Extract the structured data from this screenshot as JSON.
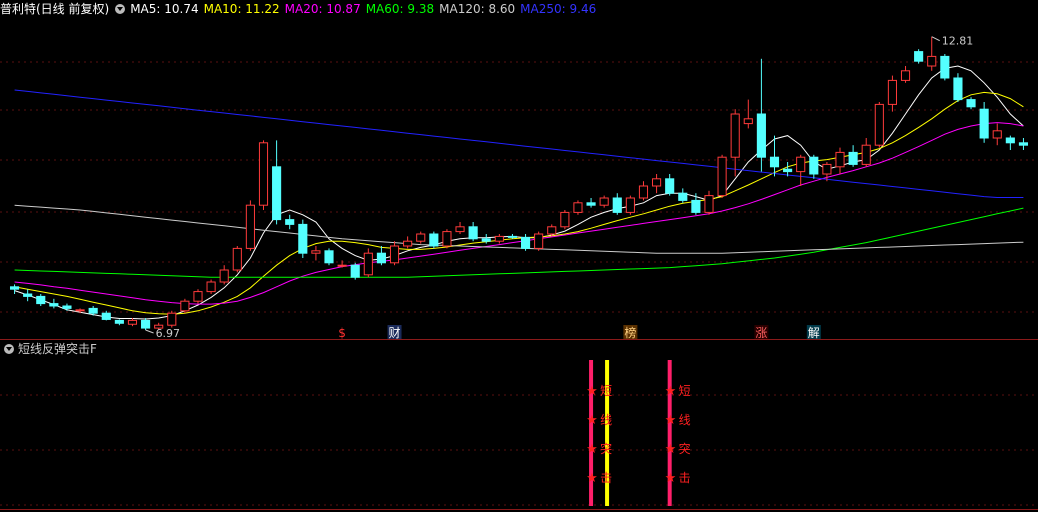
{
  "header": {
    "title": "普利特(日线 前复权)",
    "ma_items": [
      {
        "label": "MA5: 10.74",
        "color": "#ffffff"
      },
      {
        "label": "MA10: 11.22",
        "color": "#ffff00"
      },
      {
        "label": "MA20: 10.87",
        "color": "#ff00ff"
      },
      {
        "label": "MA60: 9.38",
        "color": "#00ff00"
      },
      {
        "label": "MA120: 8.60",
        "color": "#cccccc"
      },
      {
        "label": "MA250: 9.46",
        "color": "#2222ff"
      }
    ]
  },
  "indicator": {
    "title": "短线反弹突击F"
  },
  "chart_data": {
    "type": "candlestick",
    "high_label": "12.81",
    "low_label": "6.97",
    "ylim": [
      6.7,
      13.2
    ],
    "candles": [
      [
        7.6,
        7.65,
        7.45,
        7.55
      ],
      [
        7.45,
        7.55,
        7.3,
        7.4
      ],
      [
        7.4,
        7.45,
        7.2,
        7.25
      ],
      [
        7.25,
        7.35,
        7.15,
        7.2
      ],
      [
        7.2,
        7.25,
        7.1,
        7.15
      ],
      [
        7.1,
        7.15,
        7.05,
        7.12
      ],
      [
        7.15,
        7.2,
        7.0,
        7.05
      ],
      [
        7.05,
        7.1,
        6.9,
        6.92
      ],
      [
        6.9,
        6.92,
        6.8,
        6.84
      ],
      [
        6.82,
        6.95,
        6.78,
        6.9
      ],
      [
        6.9,
        6.95,
        6.7,
        6.74
      ],
      [
        6.74,
        6.85,
        6.7,
        6.8
      ],
      [
        6.8,
        7.1,
        6.75,
        7.05
      ],
      [
        7.1,
        7.35,
        7.05,
        7.3
      ],
      [
        7.3,
        7.55,
        7.25,
        7.5
      ],
      [
        7.5,
        7.75,
        7.45,
        7.7
      ],
      [
        7.7,
        8.05,
        7.65,
        7.95
      ],
      [
        7.95,
        8.45,
        7.9,
        8.4
      ],
      [
        8.4,
        9.4,
        8.35,
        9.3
      ],
      [
        9.3,
        10.65,
        9.2,
        10.6
      ],
      [
        10.1,
        10.65,
        8.9,
        9.0
      ],
      [
        9.0,
        9.1,
        8.8,
        8.9
      ],
      [
        8.9,
        9.0,
        8.2,
        8.3
      ],
      [
        8.3,
        8.45,
        8.15,
        8.35
      ],
      [
        8.35,
        8.4,
        8.05,
        8.1
      ],
      [
        8.05,
        8.15,
        8.0,
        8.05
      ],
      [
        8.05,
        8.1,
        7.75,
        7.8
      ],
      [
        7.85,
        8.4,
        7.8,
        8.3
      ],
      [
        8.3,
        8.45,
        8.05,
        8.1
      ],
      [
        8.1,
        8.55,
        8.05,
        8.45
      ],
      [
        8.45,
        8.65,
        8.4,
        8.55
      ],
      [
        8.55,
        8.75,
        8.5,
        8.7
      ],
      [
        8.7,
        8.75,
        8.4,
        8.45
      ],
      [
        8.45,
        8.8,
        8.4,
        8.75
      ],
      [
        8.75,
        8.95,
        8.7,
        8.85
      ],
      [
        8.85,
        8.95,
        8.55,
        8.6
      ],
      [
        8.6,
        8.7,
        8.5,
        8.55
      ],
      [
        8.55,
        8.7,
        8.5,
        8.65
      ],
      [
        8.65,
        8.7,
        8.6,
        8.63
      ],
      [
        8.63,
        8.7,
        8.35,
        8.4
      ],
      [
        8.4,
        8.75,
        8.35,
        8.7
      ],
      [
        8.7,
        8.9,
        8.65,
        8.85
      ],
      [
        8.85,
        9.2,
        8.8,
        9.15
      ],
      [
        9.15,
        9.4,
        9.1,
        9.35
      ],
      [
        9.35,
        9.45,
        9.25,
        9.3
      ],
      [
        9.3,
        9.5,
        9.25,
        9.45
      ],
      [
        9.45,
        9.55,
        9.1,
        9.15
      ],
      [
        9.15,
        9.5,
        9.1,
        9.45
      ],
      [
        9.45,
        9.8,
        9.4,
        9.7
      ],
      [
        9.7,
        9.95,
        9.55,
        9.85
      ],
      [
        9.85,
        9.95,
        9.5,
        9.55
      ],
      [
        9.55,
        9.65,
        9.35,
        9.4
      ],
      [
        9.4,
        9.55,
        9.1,
        9.15
      ],
      [
        9.15,
        9.6,
        9.1,
        9.5
      ],
      [
        9.5,
        10.35,
        9.45,
        10.3
      ],
      [
        10.3,
        11.3,
        9.9,
        11.2
      ],
      [
        11.0,
        11.5,
        10.9,
        11.1
      ],
      [
        11.2,
        12.35,
        10.0,
        10.3
      ],
      [
        10.3,
        10.75,
        9.9,
        10.1
      ],
      [
        10.05,
        10.2,
        9.9,
        10.0
      ],
      [
        10.0,
        10.35,
        9.7,
        10.3
      ],
      [
        10.3,
        10.35,
        9.85,
        9.95
      ],
      [
        9.95,
        10.2,
        9.8,
        10.15
      ],
      [
        10.1,
        10.5,
        9.95,
        10.4
      ],
      [
        10.4,
        10.55,
        10.1,
        10.15
      ],
      [
        10.15,
        10.7,
        10.1,
        10.55
      ],
      [
        10.55,
        11.45,
        10.5,
        11.4
      ],
      [
        11.4,
        12.0,
        11.25,
        11.9
      ],
      [
        11.9,
        12.2,
        11.85,
        12.1
      ],
      [
        12.5,
        12.55,
        12.25,
        12.3
      ],
      [
        12.2,
        12.81,
        12.1,
        12.4
      ],
      [
        12.4,
        12.45,
        11.9,
        11.95
      ],
      [
        11.95,
        12.05,
        11.45,
        11.5
      ],
      [
        11.5,
        11.55,
        11.3,
        11.35
      ],
      [
        11.3,
        11.45,
        10.6,
        10.7
      ],
      [
        10.7,
        11.0,
        10.55,
        10.85
      ],
      [
        10.7,
        10.75,
        10.45,
        10.6
      ],
      [
        10.6,
        10.7,
        10.45,
        10.55
      ]
    ],
    "ma": [
      {
        "name": "MA5",
        "color": "#ffffff",
        "values": [
          7.52,
          7.43,
          7.33,
          7.23,
          7.12,
          7.07,
          7.02,
          6.97,
          6.94,
          6.94,
          6.93,
          6.95,
          7.0,
          7.1,
          7.22,
          7.38,
          7.58,
          7.85,
          8.2,
          8.72,
          9.1,
          9.2,
          9.1,
          8.95,
          8.6,
          8.4,
          8.25,
          8.15,
          8.18,
          8.25,
          8.35,
          8.42,
          8.47,
          8.55,
          8.6,
          8.62,
          8.62,
          8.64,
          8.65,
          8.62,
          8.62,
          8.68,
          8.76,
          8.9,
          9.05,
          9.15,
          9.23,
          9.28,
          9.35,
          9.5,
          9.55,
          9.55,
          9.48,
          9.4,
          9.5,
          9.85,
          10.2,
          10.45,
          10.68,
          10.75,
          10.55,
          10.2,
          10.05,
          10.12,
          10.2,
          10.25,
          10.45,
          10.8,
          11.2,
          11.6,
          11.95,
          12.15,
          12.2,
          12.1,
          11.85,
          11.55,
          11.2,
          10.95
        ]
      },
      {
        "name": "MA10",
        "color": "#ffff00",
        "values": [
          7.6,
          7.55,
          7.5,
          7.45,
          7.4,
          7.34,
          7.28,
          7.22,
          7.16,
          7.1,
          7.06,
          7.04,
          7.03,
          7.05,
          7.1,
          7.18,
          7.28,
          7.4,
          7.58,
          7.82,
          8.05,
          8.25,
          8.4,
          8.5,
          8.55,
          8.55,
          8.52,
          8.48,
          8.42,
          8.4,
          8.38,
          8.38,
          8.4,
          8.43,
          8.47,
          8.51,
          8.54,
          8.57,
          8.6,
          8.62,
          8.64,
          8.66,
          8.7,
          8.75,
          8.82,
          8.9,
          8.98,
          9.05,
          9.12,
          9.2,
          9.28,
          9.34,
          9.38,
          9.42,
          9.48,
          9.6,
          9.72,
          9.85,
          9.98,
          10.1,
          10.18,
          10.22,
          10.25,
          10.3,
          10.35,
          10.4,
          10.48,
          10.6,
          10.75,
          10.92,
          11.1,
          11.3,
          11.48,
          11.6,
          11.65,
          11.62,
          11.52,
          11.35
        ]
      },
      {
        "name": "MA20",
        "color": "#ff00ff",
        "values": [
          7.7,
          7.67,
          7.64,
          7.6,
          7.57,
          7.53,
          7.49,
          7.45,
          7.41,
          7.37,
          7.33,
          7.3,
          7.27,
          7.25,
          7.24,
          7.24,
          7.26,
          7.3,
          7.38,
          7.48,
          7.6,
          7.72,
          7.82,
          7.9,
          7.96,
          8.02,
          8.06,
          8.1,
          8.13,
          8.16,
          8.2,
          8.24,
          8.28,
          8.32,
          8.36,
          8.4,
          8.44,
          8.48,
          8.52,
          8.56,
          8.6,
          8.64,
          8.68,
          8.72,
          8.76,
          8.8,
          8.84,
          8.88,
          8.92,
          8.96,
          9.0,
          9.04,
          9.08,
          9.12,
          9.18,
          9.25,
          9.33,
          9.42,
          9.52,
          9.62,
          9.72,
          9.8,
          9.88,
          9.95,
          10.02,
          10.1,
          10.18,
          10.28,
          10.4,
          10.52,
          10.65,
          10.78,
          10.88,
          10.95,
          11.0,
          11.02,
          11.0,
          10.95
        ]
      },
      {
        "name": "MA60",
        "color": "#00ff00",
        "values": [
          7.95,
          7.94,
          7.93,
          7.92,
          7.91,
          7.9,
          7.89,
          7.88,
          7.87,
          7.86,
          7.85,
          7.84,
          7.83,
          7.82,
          7.81,
          7.8,
          7.8,
          7.8,
          7.8,
          7.8,
          7.8,
          7.8,
          7.8,
          7.8,
          7.8,
          7.8,
          7.8,
          7.8,
          7.8,
          7.8,
          7.8,
          7.81,
          7.82,
          7.83,
          7.84,
          7.85,
          7.86,
          7.87,
          7.88,
          7.89,
          7.9,
          7.91,
          7.92,
          7.93,
          7.94,
          7.95,
          7.96,
          7.97,
          7.98,
          7.99,
          8.0,
          8.02,
          8.04,
          8.06,
          8.08,
          8.11,
          8.14,
          8.17,
          8.2,
          8.24,
          8.28,
          8.32,
          8.37,
          8.42,
          8.47,
          8.52,
          8.58,
          8.64,
          8.7,
          8.76,
          8.82,
          8.88,
          8.94,
          9.0,
          9.06,
          9.12,
          9.18,
          9.24
        ]
      },
      {
        "name": "MA120",
        "color": "#cccccc",
        "values": [
          9.3,
          9.28,
          9.26,
          9.24,
          9.22,
          9.2,
          9.17,
          9.14,
          9.11,
          9.08,
          9.05,
          9.02,
          8.99,
          8.96,
          8.93,
          8.9,
          8.87,
          8.84,
          8.81,
          8.78,
          8.75,
          8.72,
          8.69,
          8.66,
          8.63,
          8.6,
          8.58,
          8.56,
          8.54,
          8.52,
          8.5,
          8.48,
          8.47,
          8.46,
          8.45,
          8.44,
          8.43,
          8.42,
          8.41,
          8.4,
          8.39,
          8.38,
          8.37,
          8.36,
          8.35,
          8.34,
          8.33,
          8.32,
          8.31,
          8.3,
          8.3,
          8.3,
          8.3,
          8.3,
          8.3,
          8.31,
          8.32,
          8.33,
          8.34,
          8.35,
          8.36,
          8.37,
          8.38,
          8.39,
          8.4,
          8.41,
          8.42,
          8.43,
          8.44,
          8.45,
          8.46,
          8.47,
          8.48,
          8.49,
          8.5,
          8.51,
          8.52,
          8.53
        ]
      },
      {
        "name": "MA250",
        "color": "#2222ff",
        "values": [
          11.7,
          11.67,
          11.64,
          11.61,
          11.58,
          11.55,
          11.52,
          11.49,
          11.46,
          11.43,
          11.4,
          11.37,
          11.34,
          11.31,
          11.28,
          11.25,
          11.22,
          11.19,
          11.16,
          11.13,
          11.1,
          11.07,
          11.04,
          11.01,
          10.98,
          10.95,
          10.92,
          10.89,
          10.86,
          10.83,
          10.8,
          10.77,
          10.74,
          10.71,
          10.68,
          10.65,
          10.62,
          10.59,
          10.56,
          10.53,
          10.5,
          10.47,
          10.44,
          10.41,
          10.38,
          10.35,
          10.32,
          10.29,
          10.26,
          10.23,
          10.2,
          10.17,
          10.14,
          10.11,
          10.08,
          10.05,
          10.02,
          9.99,
          9.96,
          9.93,
          9.9,
          9.87,
          9.84,
          9.81,
          9.78,
          9.75,
          9.72,
          9.69,
          9.66,
          9.63,
          9.6,
          9.57,
          9.54,
          9.51,
          9.48,
          9.46,
          9.46,
          9.46
        ]
      }
    ],
    "events": [
      {
        "index": 25,
        "text": "$",
        "color": "#ff3030",
        "bg": ""
      },
      {
        "index": 29,
        "text": "财",
        "color": "#ffffff",
        "bg": "#1a2a5a"
      },
      {
        "index": 47,
        "text": "榜",
        "color": "#ffd080",
        "bg": "#5a3000"
      },
      {
        "index": 57,
        "text": "涨",
        "color": "#ff6060",
        "bg": "#2a0000"
      },
      {
        "index": 61,
        "text": "解",
        "color": "#ffffff",
        "bg": "#003a4a"
      }
    ],
    "signals": [
      {
        "index": 44,
        "chars": [
          "短",
          "线",
          "突",
          "击"
        ],
        "yellow": true
      },
      {
        "index": 50,
        "chars": [
          "短",
          "线",
          "突",
          "击"
        ],
        "yellow": false
      }
    ]
  }
}
